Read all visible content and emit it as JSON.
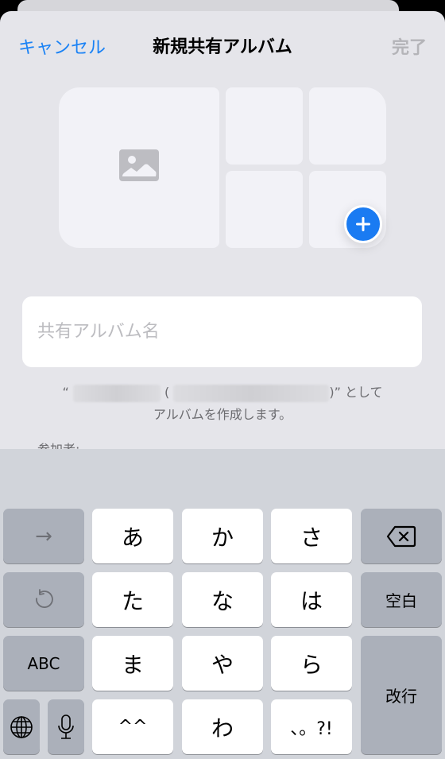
{
  "nav": {
    "cancel_label": "キャンセル",
    "title": "新規共有アルバム",
    "done_label": "完了"
  },
  "colors": {
    "accent": "#1a82f5",
    "disabled": "#b4b4b8",
    "sheet_bg": "#e5e5ea",
    "keyboard_bg": "#d1d4da"
  },
  "album_name": {
    "value": "",
    "placeholder": "共有アルバム名"
  },
  "info": {
    "quote_open": "“",
    "paren_open": "(",
    "suffix": ")” として",
    "line2": "アルバムを作成します。"
  },
  "participants_label": "参加者:",
  "keyboard": {
    "next_label": "→",
    "undo_icon": "undo-icon",
    "abc_label": "ABC",
    "globe_icon": "globe-icon",
    "mic_icon": "microphone-icon",
    "delete_icon": "delete-backward-icon",
    "space_label": "空白",
    "return_label": "改行",
    "kana_keys": [
      "あ",
      "か",
      "さ",
      "た",
      "な",
      "は",
      "ま",
      "や",
      "ら",
      "^^",
      "わ",
      "、。?!"
    ]
  }
}
